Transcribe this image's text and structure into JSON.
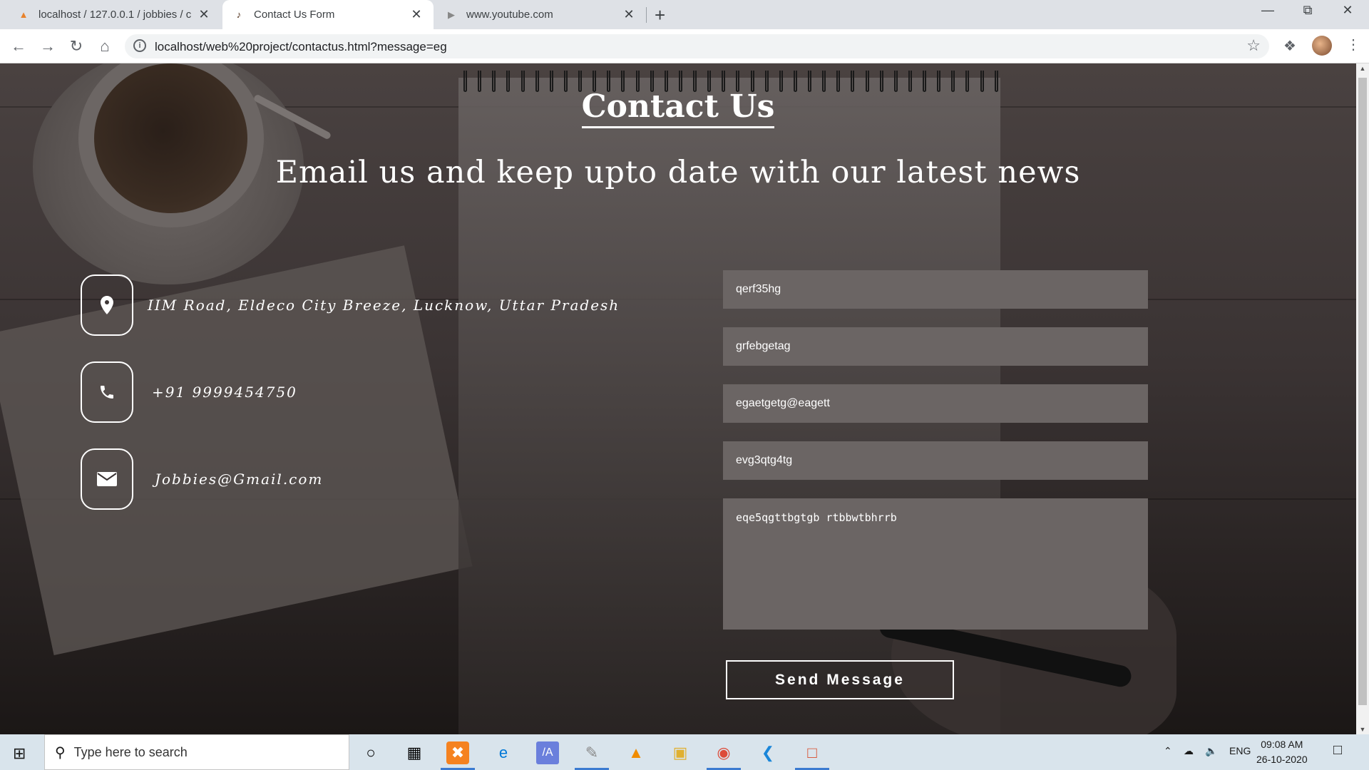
{
  "browser": {
    "tabs": [
      {
        "title": "localhost / 127.0.0.1 / jobbies / c",
        "icon": "phpmyadmin-icon"
      },
      {
        "title": "Contact Us Form",
        "icon": "page-favicon-icon"
      },
      {
        "title": "www.youtube.com",
        "icon": "youtube-icon"
      }
    ],
    "url": "localhost/web%20project/contactus.html?message=eg"
  },
  "page": {
    "title": "Contact Us",
    "subtitle": "Email us and keep upto date with our latest news",
    "info": [
      {
        "icon": "location-pin-icon",
        "text": "IIM Road, Eldeco City Breeze, Lucknow, Uttar Pradesh"
      },
      {
        "icon": "phone-icon",
        "text": "+91 9999454750"
      },
      {
        "icon": "envelope-icon",
        "text": "Jobbies@Gmail.com"
      }
    ],
    "form": {
      "field1": "qerf35hg",
      "field2": "grfebgetag",
      "email": "egaetgetg@eagett",
      "field4": "evg3qtg4tg",
      "message": "eqe5qgttbgtgb rtbbwtbhrrb",
      "send_label": "Send Message"
    }
  },
  "taskbar": {
    "search_placeholder": "Type here to search",
    "language": "ENG",
    "time": "09:08 AM",
    "date": "26-10-2020"
  }
}
